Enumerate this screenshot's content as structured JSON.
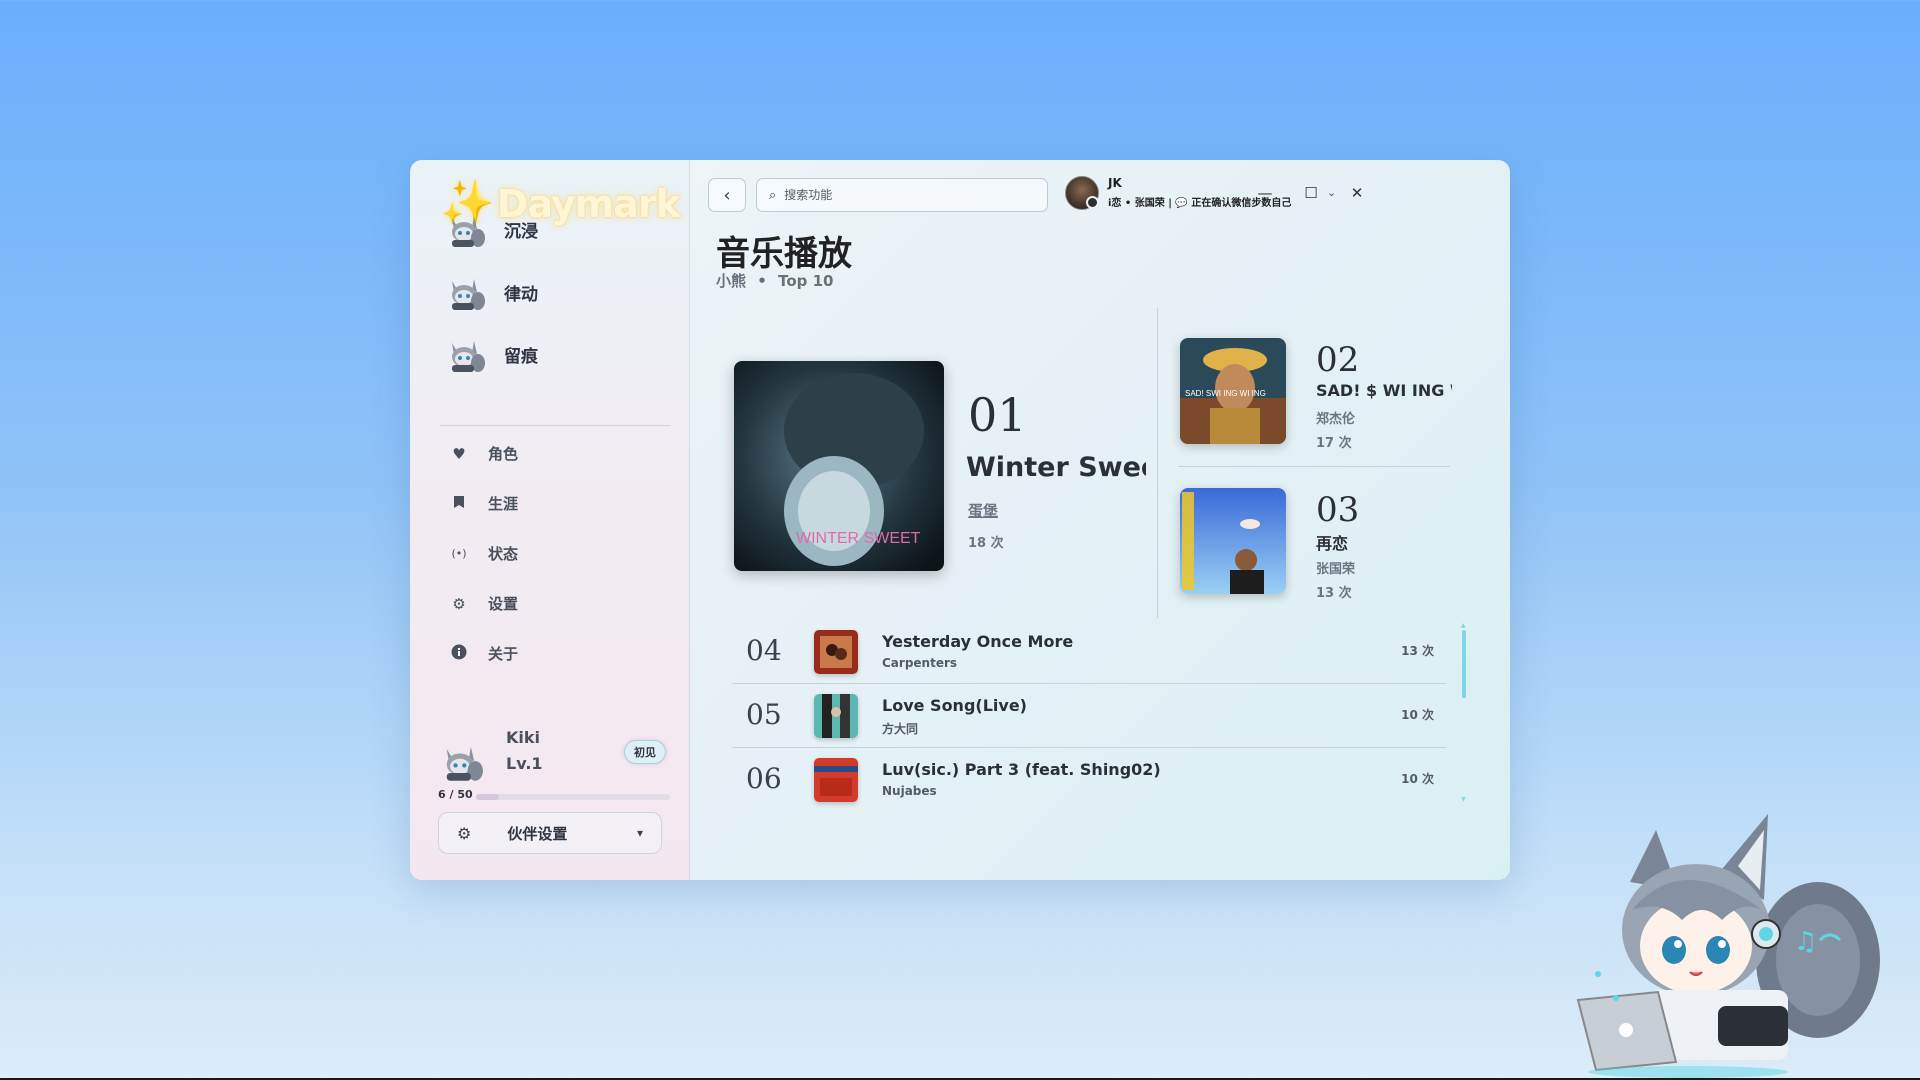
{
  "app": {
    "logo_text": "Daymark",
    "accent": "#7ed6e6"
  },
  "sidebar": {
    "primary": [
      {
        "label": "沉浸",
        "icon": "cat-avatar-icon"
      },
      {
        "label": "律动",
        "icon": "cat-avatar-icon"
      },
      {
        "label": "留痕",
        "icon": "cat-avatar-icon"
      }
    ],
    "secondary": [
      {
        "label": "角色",
        "icon": "heart-icon"
      },
      {
        "label": "生涯",
        "icon": "bookmark-icon"
      },
      {
        "label": "状态",
        "icon": "broadcast-icon"
      },
      {
        "label": "设置",
        "icon": "gear-icon"
      },
      {
        "label": "关于",
        "icon": "info-icon"
      }
    ],
    "profile": {
      "name": "Kiki",
      "level": "Lv.1",
      "badge": "初见",
      "xp_text": "6 / 50",
      "xp_fraction": 0.12
    },
    "companion_button": "伙伴设置"
  },
  "topbar": {
    "search_placeholder": "搜索功能",
    "user_name": "JK",
    "user_status": "i恋 • 张国荣 | 💬 正在确认微信步数自己",
    "window_controls": [
      "minimize",
      "maximize",
      "close"
    ]
  },
  "page": {
    "title": "音乐播放",
    "subtitle_user": "小熊",
    "subtitle_sep": "•",
    "subtitle_scope": "Top 10"
  },
  "top_tracks": [
    {
      "rank": "01",
      "title": "Winter Sweet",
      "artist": "蛋堡",
      "count": "18 次",
      "cover_text": "WINTER SWEET"
    },
    {
      "rank": "02",
      "title": "SAD! $ WI ING W",
      "artist": "郑杰伦",
      "count": "17 次",
      "cover_text": "SAD! SWI ING WI ING"
    },
    {
      "rank": "03",
      "title": "再恋",
      "artist": "张国荣",
      "count": "13 次"
    }
  ],
  "track_list": [
    {
      "rank": "04",
      "title": "Yesterday Once More",
      "artist": "Carpenters",
      "count": "13 次"
    },
    {
      "rank": "05",
      "title": "Love Song(Live)",
      "artist": "方大同",
      "count": "10 次"
    },
    {
      "rank": "06",
      "title": "Luv(sic.) Part 3 (feat. Shing02)",
      "artist": "Nujabes",
      "count": "10 次"
    }
  ]
}
